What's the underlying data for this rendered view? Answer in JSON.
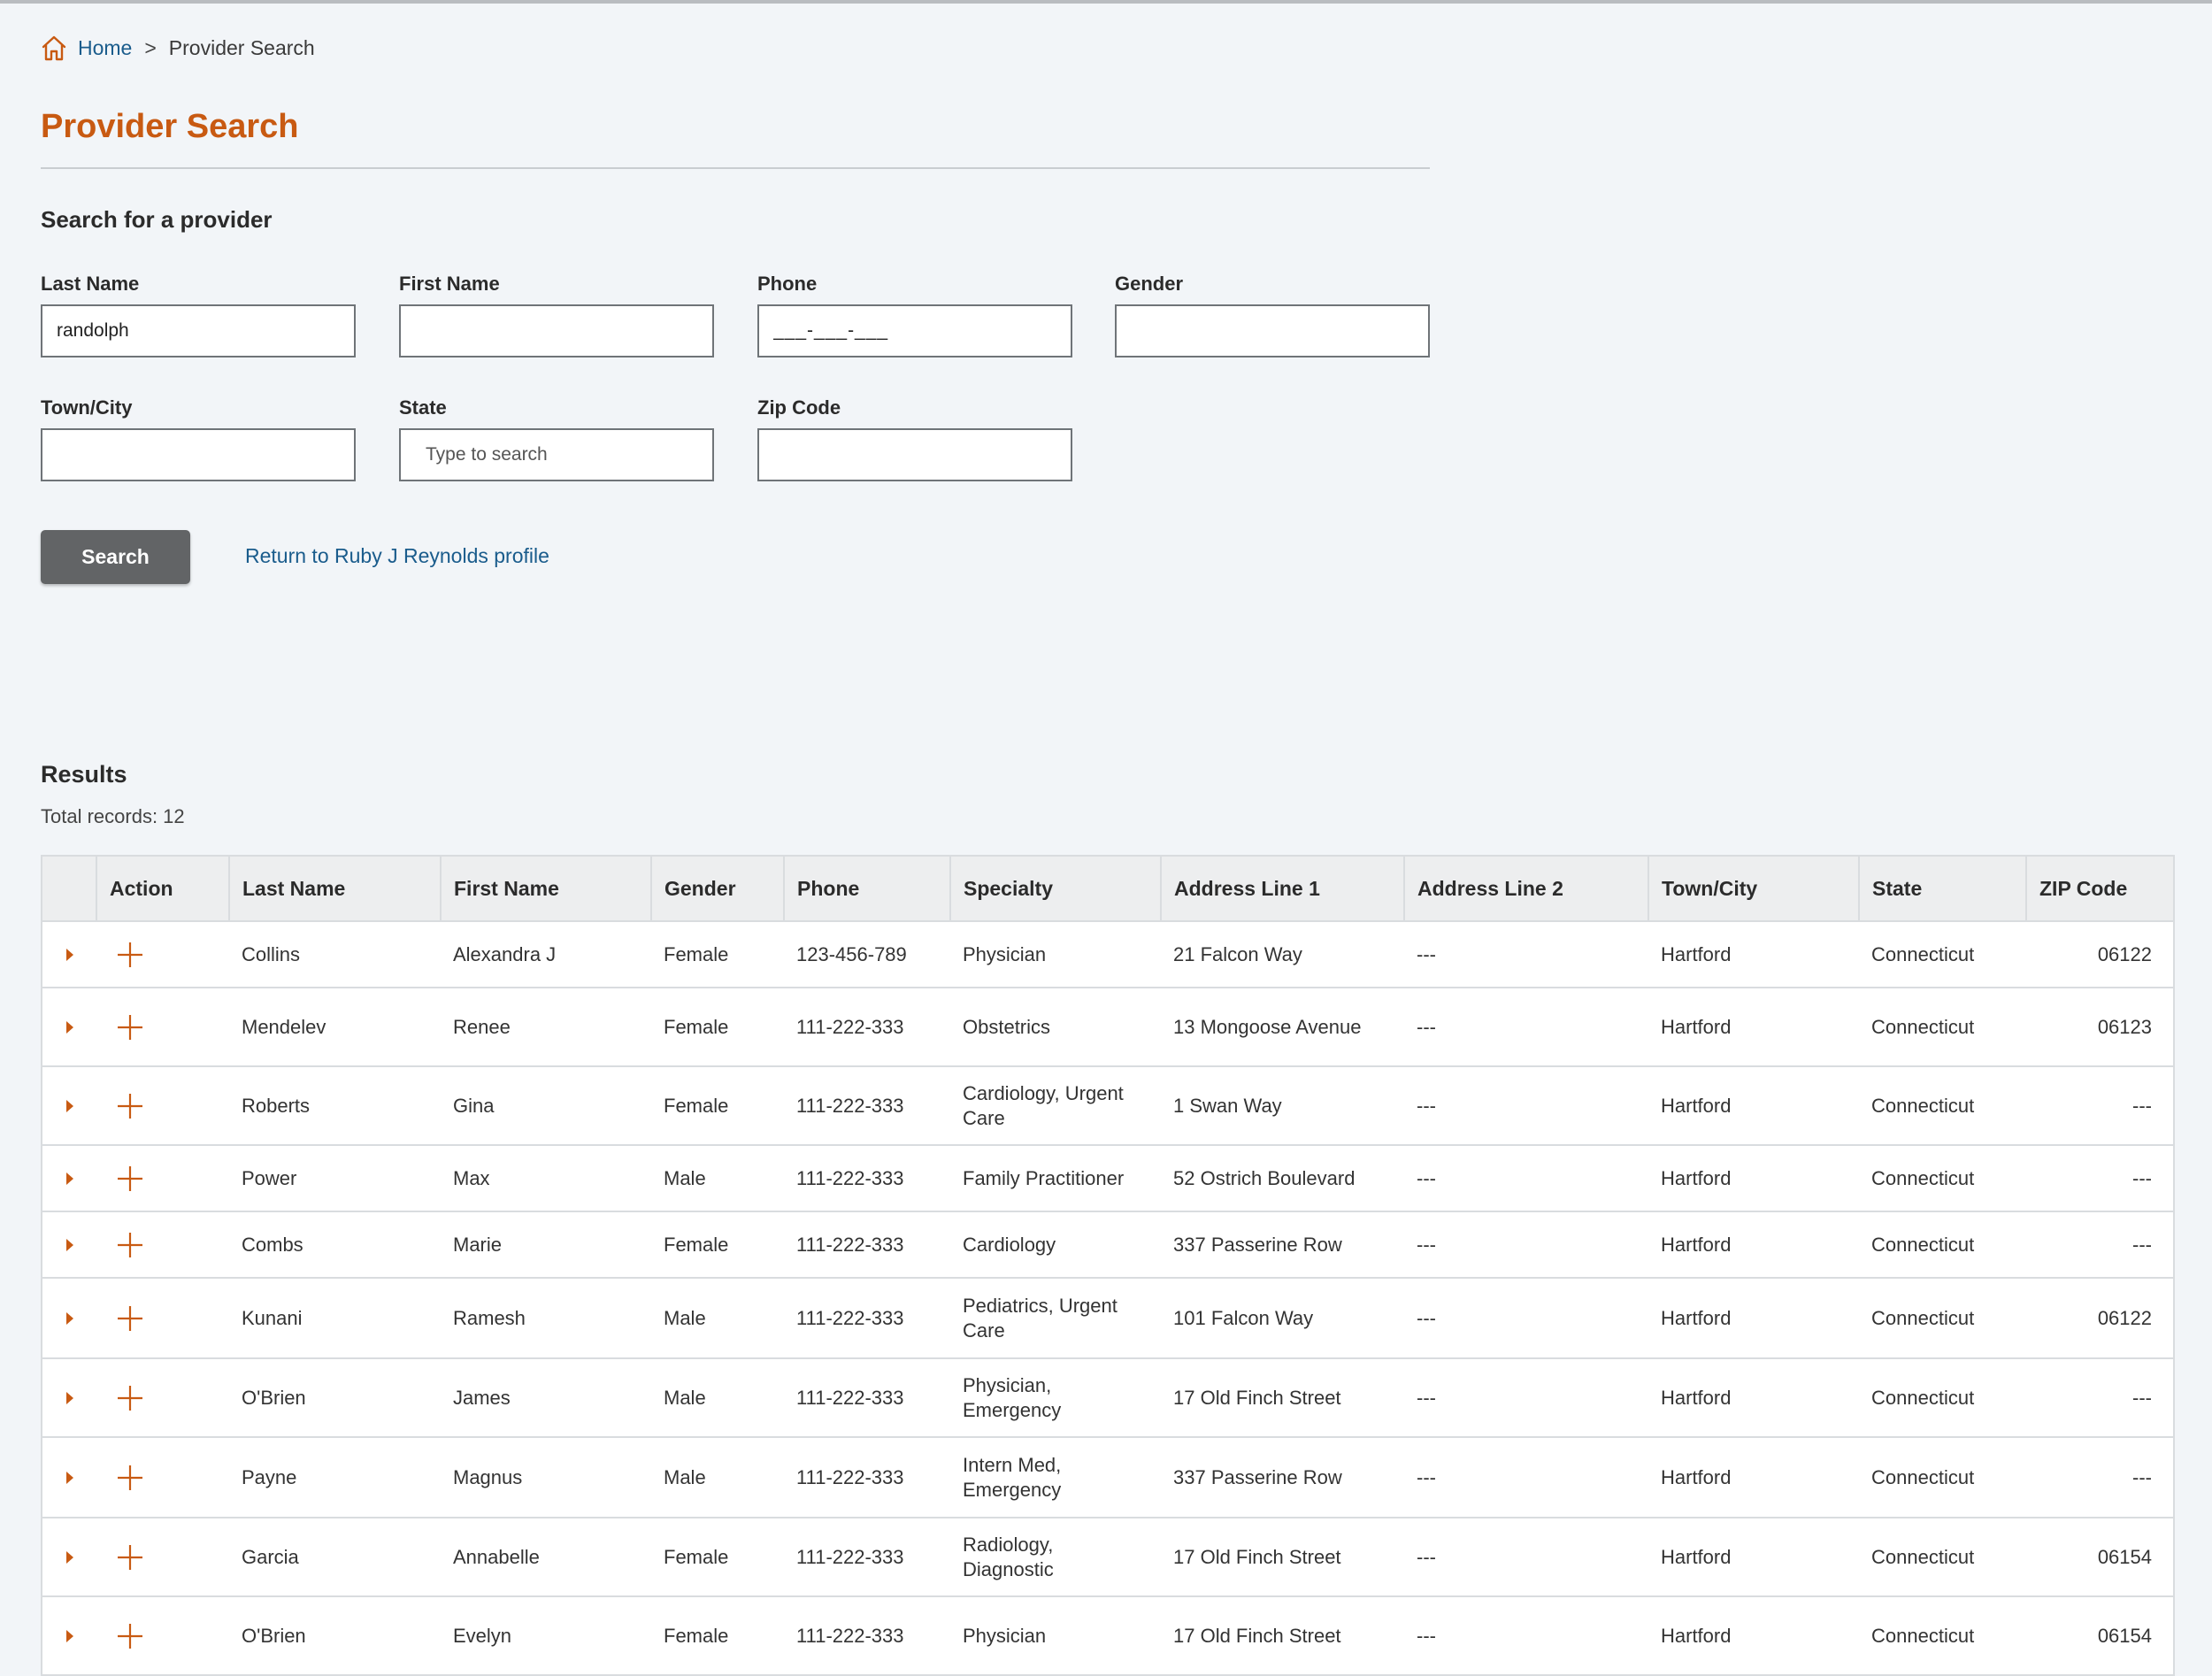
{
  "breadcrumb": {
    "home": "Home",
    "separator": ">",
    "current": "Provider Search"
  },
  "page_title": "Provider Search",
  "search": {
    "heading": "Search for a provider",
    "fields": {
      "last_name": {
        "label": "Last Name",
        "value": "randolph"
      },
      "first_name": {
        "label": "First Name",
        "value": ""
      },
      "phone": {
        "label": "Phone",
        "placeholder": "___-___-___"
      },
      "gender": {
        "label": "Gender",
        "value": ""
      },
      "town_city": {
        "label": "Town/City",
        "value": ""
      },
      "state": {
        "label": "State",
        "placeholder": "Type to search"
      },
      "zip_code": {
        "label": "Zip Code",
        "value": ""
      }
    },
    "search_button": "Search",
    "return_link": "Return to Ruby J Reynolds profile"
  },
  "results": {
    "heading": "Results",
    "total": "Total records: 12",
    "columns": [
      "",
      "Action",
      "Last Name",
      "First Name",
      "Gender",
      "Phone",
      "Specialty",
      "Address Line 1",
      "Address Line 2",
      "Town/City",
      "State",
      "ZIP Code"
    ],
    "rows": [
      {
        "last": "Collins",
        "first": "Alexandra J",
        "gender": "Female",
        "phone": "123-456-789",
        "specialty": "Physician",
        "addr1": "21 Falcon Way",
        "addr2": "---",
        "town": "Hartford",
        "state": "Connecticut",
        "zip": "06122"
      },
      {
        "last": "Mendelev",
        "first": "Renee",
        "gender": "Female",
        "phone": "111-222-333",
        "specialty": "Obstetrics",
        "addr1": "13 Mongoose Avenue",
        "addr2": "---",
        "town": "Hartford",
        "state": "Connecticut",
        "zip": "06123"
      },
      {
        "last": "Roberts",
        "first": "Gina",
        "gender": "Female",
        "phone": "111-222-333",
        "specialty": "Cardiology, Urgent Care",
        "addr1": "1 Swan Way",
        "addr2": "---",
        "town": "Hartford",
        "state": "Connecticut",
        "zip": "---"
      },
      {
        "last": "Power",
        "first": "Max",
        "gender": "Male",
        "phone": "111-222-333",
        "specialty": "Family Practitioner",
        "addr1": "52 Ostrich Boulevard",
        "addr2": "---",
        "town": "Hartford",
        "state": "Connecticut",
        "zip": "---"
      },
      {
        "last": "Combs",
        "first": "Marie",
        "gender": "Female",
        "phone": "111-222-333",
        "specialty": "Cardiology",
        "addr1": "337 Passerine Row",
        "addr2": "---",
        "town": "Hartford",
        "state": "Connecticut",
        "zip": "---"
      },
      {
        "last": "Kunani",
        "first": "Ramesh",
        "gender": "Male",
        "phone": "111-222-333",
        "specialty": "Pediatrics, Urgent Care",
        "addr1": "101 Falcon Way",
        "addr2": "---",
        "town": "Hartford",
        "state": "Connecticut",
        "zip": "06122"
      },
      {
        "last": "O'Brien",
        "first": "James",
        "gender": "Male",
        "phone": "111-222-333",
        "specialty": "Physician, Emergency",
        "addr1": "17 Old Finch Street",
        "addr2": "---",
        "town": "Hartford",
        "state": "Connecticut",
        "zip": "---"
      },
      {
        "last": "Payne",
        "first": "Magnus",
        "gender": "Male",
        "phone": "111-222-333",
        "specialty": "Intern Med, Emergency",
        "addr1": "337 Passerine Row",
        "addr2": "---",
        "town": "Hartford",
        "state": "Connecticut",
        "zip": "---"
      },
      {
        "last": "Garcia",
        "first": "Annabelle",
        "gender": "Female",
        "phone": "111-222-333",
        "specialty": "Radiology, Diagnostic",
        "addr1": "17 Old Finch Street",
        "addr2": "---",
        "town": "Hartford",
        "state": "Connecticut",
        "zip": "06154"
      },
      {
        "last": "O'Brien",
        "first": "Evelyn",
        "gender": "Female",
        "phone": "111-222-333",
        "specialty": "Physician",
        "addr1": "17 Old Finch Street",
        "addr2": "---",
        "town": "Hartford",
        "state": "Connecticut",
        "zip": "06154"
      }
    ]
  },
  "colors": {
    "accent": "#c85a12",
    "link": "#1a5c8c",
    "button": "#626466",
    "background": "#f2f5f8"
  },
  "icons": {
    "home": "home-icon",
    "expand": "chevron-right-icon",
    "add": "plus-icon"
  }
}
